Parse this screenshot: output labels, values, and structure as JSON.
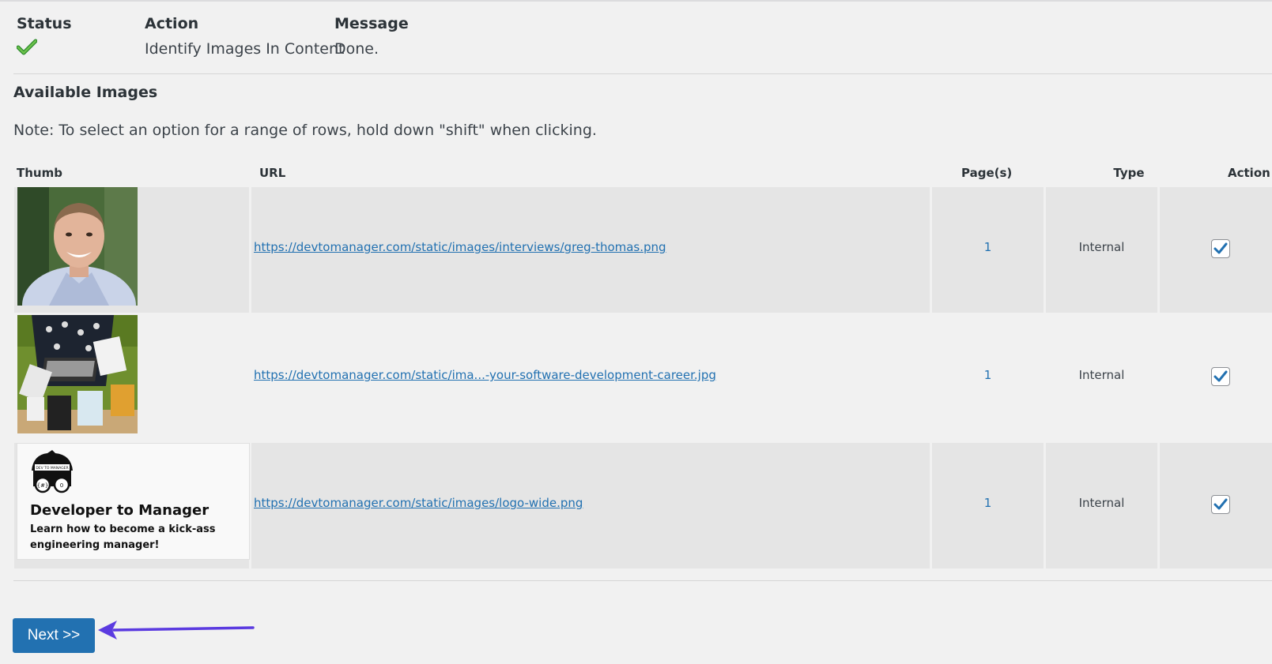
{
  "status_table": {
    "headers": {
      "status": "Status",
      "action": "Action",
      "message": "Message"
    },
    "row": {
      "status_icon": "checkmark-icon",
      "action": "Identify Images In Content",
      "message": "Done."
    }
  },
  "section_title": "Available Images",
  "note": "Note: To select an option for a range of rows, hold down \"shift\" when clicking.",
  "images_table": {
    "headers": {
      "thumb": "Thumb",
      "url": "URL",
      "pages": "Page(s)",
      "type": "Type",
      "action": "Action"
    },
    "rows": [
      {
        "thumb": "portrait-photo",
        "url": "https://devtomanager.com/static/images/interviews/greg-thomas.png",
        "pages": "1",
        "type": "Internal",
        "checked": true
      },
      {
        "thumb": "laptop-books-photo",
        "url": "https://devtomanager.com/static/ima...-your-software-development-career.jpg",
        "pages": "1",
        "type": "Internal",
        "checked": true
      },
      {
        "thumb": "logo-card",
        "url": "https://devtomanager.com/static/images/logo-wide.png",
        "pages": "1",
        "type": "Internal",
        "checked": true
      }
    ],
    "logo_card": {
      "badge": "DEV TO MANAGER",
      "title": "Developer to Manager",
      "subtitle": "Learn how to become a kick-ass engineering manager!"
    }
  },
  "next_button": "Next >>",
  "colors": {
    "accent": "#2271b1",
    "arrow": "#5b3be0",
    "check": "#46b450"
  }
}
